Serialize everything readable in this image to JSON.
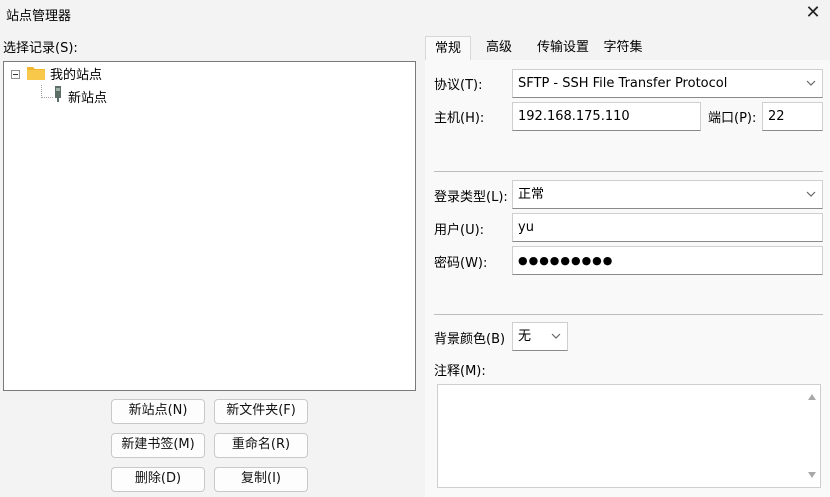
{
  "window": {
    "title": "站点管理器",
    "close_glyph": "✕"
  },
  "left": {
    "label": "选择记录(S):",
    "tree": [
      {
        "label": "我的站点",
        "icon": "folder-icon"
      },
      {
        "label": "新站点",
        "icon": "site-icon"
      }
    ],
    "buttons": {
      "new_site": "新站点(N)",
      "new_folder": "新文件夹(F)",
      "new_bookmark": "新建书签(M)",
      "rename": "重命名(R)",
      "delete": "删除(D)",
      "copy": "复制(I)"
    }
  },
  "tabs": [
    "常规",
    "高级",
    "传输设置",
    "字符集"
  ],
  "general": {
    "protocol_label": "协议(T):",
    "protocol_value": "SFTP - SSH File Transfer Protocol",
    "host_label": "主机(H):",
    "host_value": "192.168.175.110",
    "port_label": "端口(P):",
    "port_value": "22",
    "logon_label": "登录类型(L):",
    "logon_value": "正常",
    "user_label": "用户(U):",
    "user_value": "yu",
    "password_label": "密码(W):",
    "password_value": "●●●●●●●●●",
    "bgcolor_label": "背景颜色(B)",
    "bgcolor_value": "无",
    "comments_label": "注释(M):"
  },
  "colors": {
    "folder": "#f2b631",
    "site": "#5b6f66",
    "window_bg": "#f3f3f3",
    "panel_bg": "#f9f9f9"
  }
}
